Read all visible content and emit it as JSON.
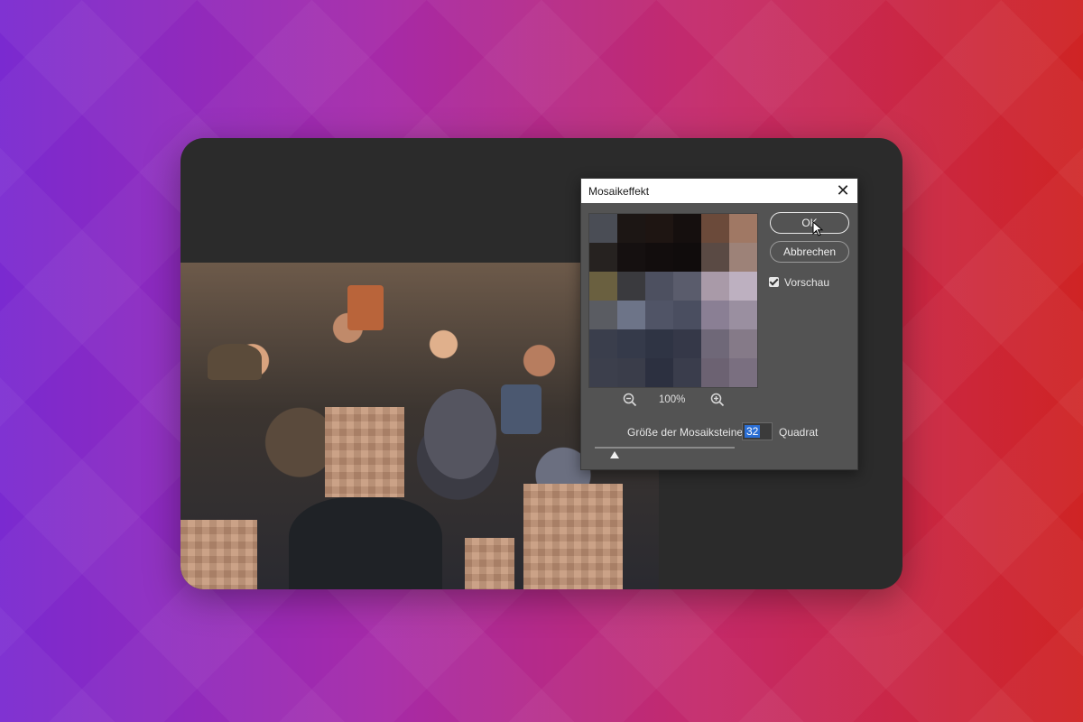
{
  "dialog": {
    "title": "Mosaikeffekt",
    "ok_label": "OK",
    "cancel_label": "Abbrechen",
    "preview_label": "Vorschau",
    "preview_checked": true,
    "zoom_level": "100%",
    "size_label": "Größe der Mosaiksteine:",
    "size_value": "32",
    "size_unit": "Quadrat",
    "slider_fraction": 0.14
  },
  "preview_colors": [
    "#4a4d55",
    "#1c1614",
    "#1e1512",
    "#150f0e",
    "#6b4a3a",
    "#a07864",
    "#262220",
    "#151010",
    "#120d0d",
    "#100c0c",
    "#5a4a44",
    "#9d8278",
    "#6a6040",
    "#3a3a3e",
    "#4d5060",
    "#5a5c6c",
    "#a99aa8",
    "#bdb0c0",
    "#5a5c62",
    "#6d7488",
    "#505466",
    "#4a4e60",
    "#8a7f94",
    "#9a8fa0",
    "#3a3e4c",
    "#353a4a",
    "#2f3444",
    "#353848",
    "#6f6878",
    "#857a88",
    "#3c3f4c",
    "#3a3d4a",
    "#2c3040",
    "#3a3d4c",
    "#6c6272",
    "#7a6f80"
  ],
  "icons": {
    "zoom_out": "zoom-out-icon",
    "zoom_in": "zoom-in-icon",
    "close": "close-icon",
    "cursor": "mouse-cursor-icon"
  }
}
